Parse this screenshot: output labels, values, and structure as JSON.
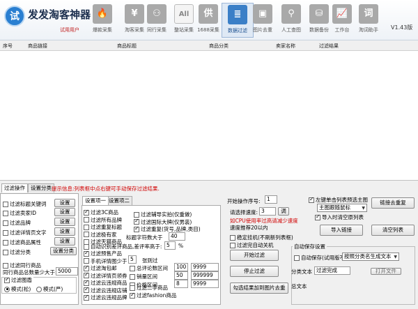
{
  "app": {
    "logo_char": "试",
    "title": "发发淘客神器",
    "subtitle": "试用用户",
    "version": "V1.43版"
  },
  "nav": [
    {
      "label": "爆款采集",
      "icon": "fire-icon",
      "glyph": "🔥"
    },
    {
      "label": "淘客采集",
      "icon": "yen-icon",
      "glyph": "¥"
    },
    {
      "label": "同行采集",
      "icon": "people-icon",
      "glyph": "⚇"
    },
    {
      "label": "整站采集",
      "icon": "all-icon",
      "glyph": "All"
    },
    {
      "label": "1688采集",
      "icon": "supply-icon",
      "glyph": "供"
    },
    {
      "label": "数据过滤",
      "icon": "filter-icon",
      "glyph": "≣"
    },
    {
      "label": "图片去重",
      "icon": "image-icon",
      "glyph": "▣"
    },
    {
      "label": "人工查图",
      "icon": "person-icon",
      "glyph": "⚲"
    },
    {
      "label": "数据备份",
      "icon": "database-icon",
      "glyph": "⛁"
    },
    {
      "label": "工作台",
      "icon": "chart-icon",
      "glyph": "📈"
    },
    {
      "label": "淘词助手",
      "icon": "word-icon",
      "glyph": "词"
    }
  ],
  "grid": {
    "columns": [
      "序号",
      "商品链接",
      "商品标题",
      "商品分类",
      "卖家名称",
      "过滤结果"
    ]
  },
  "left_tabs": [
    "过滤操作",
    "设置分类"
  ],
  "hint": "提示信息:列表框中点右键可手动保存过滤结果.",
  "left": {
    "rows": [
      {
        "label": "过滤标题关键词",
        "checked": false,
        "button": "设置"
      },
      {
        "label": "过滤卖家ID",
        "checked": false,
        "button": "设置"
      },
      {
        "label": "过滤品牌",
        "checked": false,
        "button": "设置"
      },
      {
        "label": "过滤详情页文字",
        "checked": false,
        "button": "设置"
      },
      {
        "label": "过滤商品属性",
        "checked": false,
        "button": "设置"
      },
      {
        "label": "过滤分类",
        "checked": false,
        "button": "设置分类"
      }
    ],
    "peer_label": "过滤同行商品",
    "peer_checked": false,
    "peer_count_label": "同行商品总数量少大于:",
    "peer_count_value": "5000",
    "image_filter_label": "过滤图盾",
    "image_filter_checked": true,
    "mode_a": "模式(松)",
    "mode_b": "模式(严)"
  },
  "mid_tabs": [
    "设置项一",
    "设置项二"
  ],
  "mid": {
    "col1": [
      {
        "label": "过滤3C商品",
        "checked": true
      },
      {
        "label": "过滤所有品牌",
        "checked": false
      },
      {
        "label": "过滤重复标题",
        "checked": false
      },
      {
        "label": "过滤极有家",
        "checked": false
      },
      {
        "label": "过滤天猫商品",
        "checked": false
      }
    ],
    "col2": [
      {
        "label": "过滤辅导实拍(仅重做)",
        "checked": false
      },
      {
        "label": "过滤国际大牌(仅男装)",
        "checked": true
      },
      {
        "label": "过滤重复(货号,品牌,类目)",
        "checked": true
      }
    ],
    "title_char_label": "标题字符数大于",
    "title_char_value": "40",
    "auto_neg_label": "自动识别差评商品,差评率高于:",
    "auto_neg_value": "5",
    "auto_neg_unit": "%",
    "col1b": [
      {
        "label": "过滤预售产品",
        "checked": true
      },
      {
        "label": "手机详情图少于",
        "checked": false,
        "value": "5",
        "suffix": "张则过"
      },
      {
        "label": "过滤淘包邮",
        "checked": true
      },
      {
        "label": "过滤详情页领券",
        "checked": true
      },
      {
        "label": "过滤云违规商品",
        "checked": true
      },
      {
        "label": "过滤云违规店铺",
        "checked": true
      },
      {
        "label": "过滤云违规品牌",
        "checked": true
      }
    ],
    "ranges": [
      {
        "label": "总评论数区间",
        "checked": false,
        "min": "100",
        "max": "9999"
      },
      {
        "label": "销量区间",
        "checked": false,
        "min": "50",
        "max": "999999"
      },
      {
        "label": "价格区间",
        "checked": false,
        "min": "8",
        "max": "9999"
      }
    ],
    "second_hand_label": "过滤二手商品",
    "fashion_label": "过滤fashion商品"
  },
  "right": {
    "start_seq_label": "开始操作序号:",
    "start_seq_value": "1",
    "speed_label": "请选择速度:",
    "speed_value": "3",
    "speed_btn": "调",
    "cpu_hint": "如CPU使用率过高请减少速度",
    "speed_hint": "速度推荐20以内",
    "stable_label": "稳定挂机(不刷新列表框)",
    "shutdown_label": "过滤完自动关机",
    "start_btn": "开始过滤",
    "stop_btn": "停止过滤",
    "add_btn": "勾选结果加到图片去重",
    "left_click_label": "左键单击列表预选主图",
    "left_click_checked": true,
    "main_pic_option": "主图跟随鼠标",
    "link_dedupe_btn": "链接去重复",
    "import_label": "导入时清空原列表",
    "import_checked": true,
    "import_btn": "导入链接",
    "clear_btn": "清空列表",
    "autosave_title": "自动保存设置",
    "autosave_label": "自动保存(试用版不",
    "autosave_option": "按照分类名生成文本",
    "category_label": "分类文本",
    "result_option": "过滤完成",
    "open_btn": "打开文件",
    "total_label": "总文本"
  }
}
